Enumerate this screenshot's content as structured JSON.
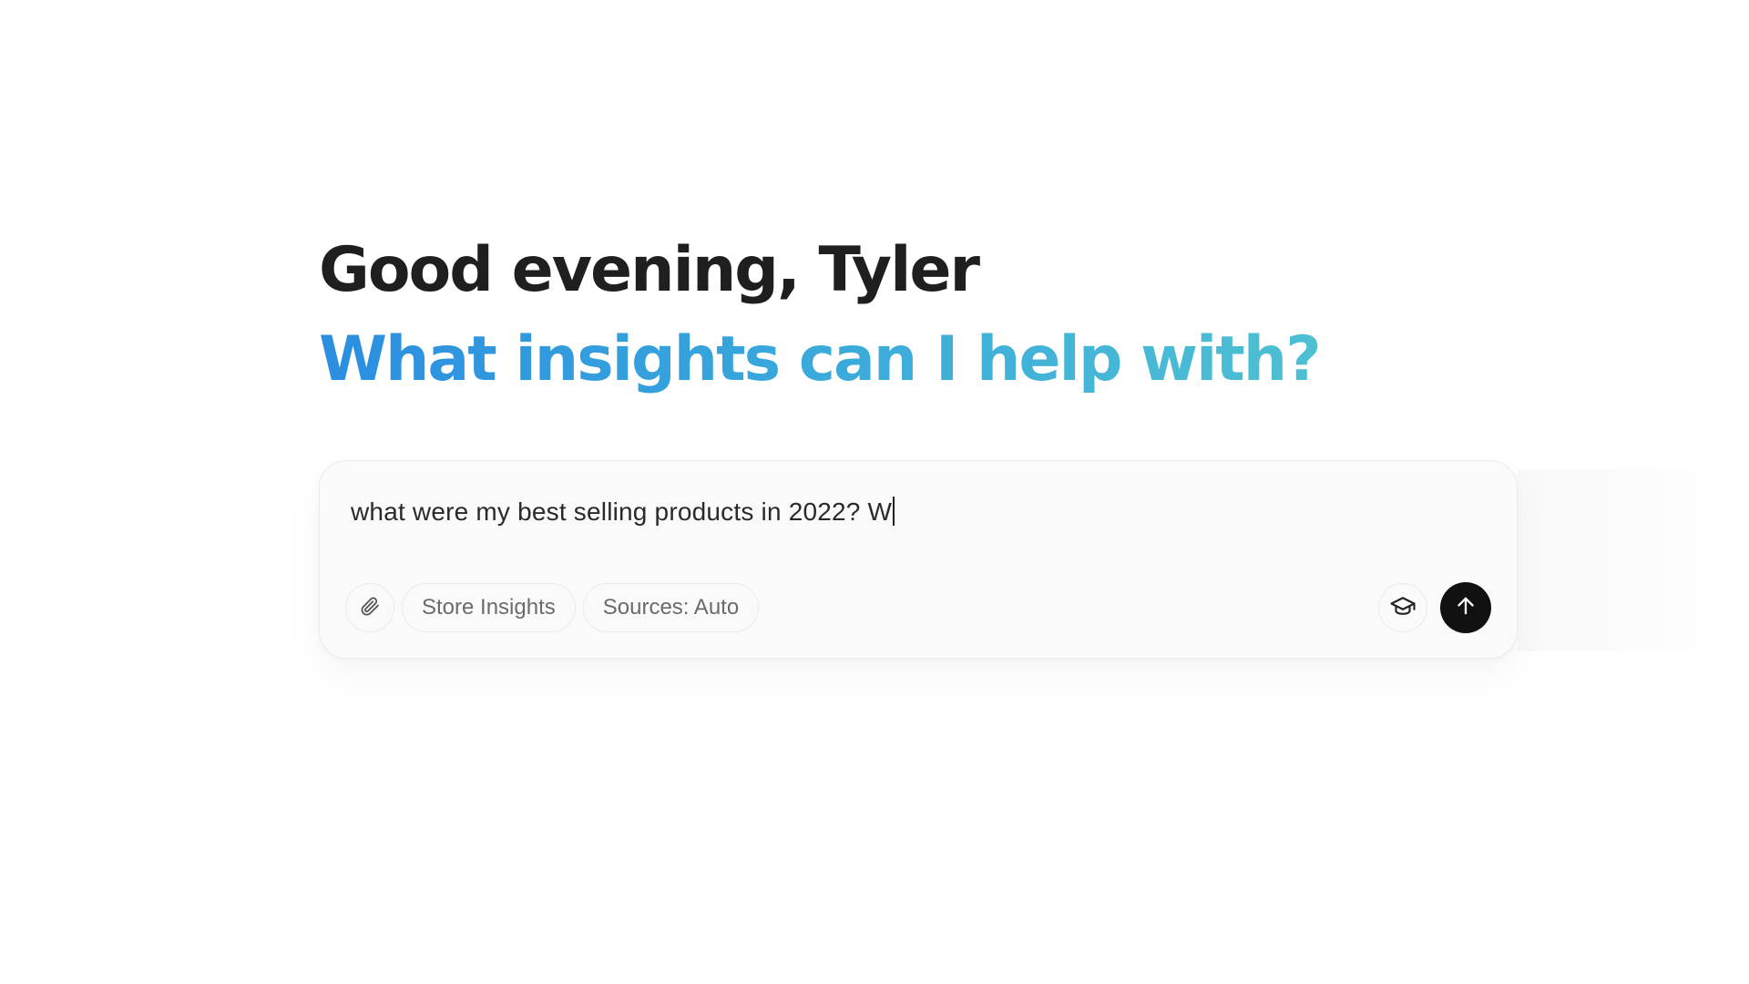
{
  "greeting": "Good evening, Tyler",
  "subheading": "What insights can I help with?",
  "composer": {
    "query_value": "what were my best selling products in 2022? W",
    "chips": {
      "store_insights": "Store Insights",
      "sources": "Sources: Auto"
    }
  },
  "icons": {
    "attach": "paperclip-icon",
    "mode": "graduation-cap-icon",
    "send": "arrow-up-icon"
  },
  "colors": {
    "heading": "#1f1f1f",
    "gradient_start": "#2b8ee0",
    "gradient_end": "#4ec0d3",
    "send_button": "#111111"
  }
}
